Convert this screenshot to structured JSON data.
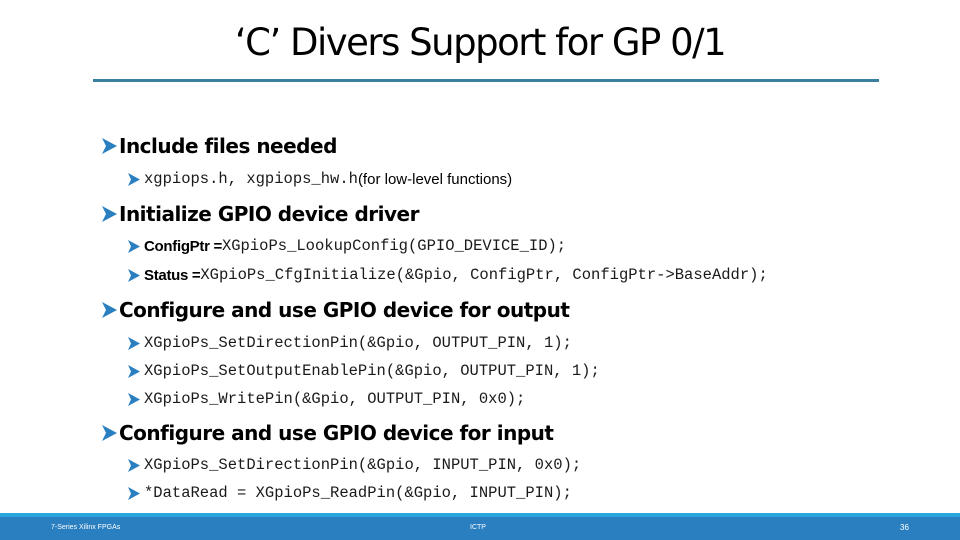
{
  "slide": {
    "title": "‘C’ Divers Support for GP 0/1",
    "accent_color": "#3a7fa0",
    "bullet_color": "#2a7fc1",
    "sections": [
      {
        "heading": "Include files needed",
        "items": [
          {
            "code": "xgpiops.h, xgpiops_hw.h",
            "note": " (for low-level functions)"
          }
        ]
      },
      {
        "heading": "Initialize GPIO device driver",
        "items": [
          {
            "label": "ConfigPtr = ",
            "code": "XGpioPs_LookupConfig(GPIO_DEVICE_ID);"
          },
          {
            "label": "Status = ",
            "code": "XGpioPs_CfgInitialize(&Gpio, ConfigPtr, ConfigPtr->BaseAddr);"
          }
        ]
      },
      {
        "heading": "Configure and use GPIO device for output",
        "items": [
          {
            "code": "XGpioPs_SetDirectionPin(&Gpio, OUTPUT_PIN, 1);"
          },
          {
            "code": "XGpioPs_SetOutputEnablePin(&Gpio, OUTPUT_PIN, 1);"
          },
          {
            "code": "XGpioPs_WritePin(&Gpio, OUTPUT_PIN, 0x0);"
          }
        ]
      },
      {
        "heading": "Configure and use GPIO device for input",
        "items": [
          {
            "code": "XGpioPs_SetDirectionPin(&Gpio, INPUT_PIN, 0x0);"
          },
          {
            "code": "*DataRead = XGpioPs_ReadPin(&Gpio, INPUT_PIN);"
          }
        ]
      }
    ]
  },
  "footer": {
    "left": "7-Series Xilinx FPGAs",
    "center": "ICTP",
    "page_number": "36",
    "color": "#2a7fc1"
  }
}
